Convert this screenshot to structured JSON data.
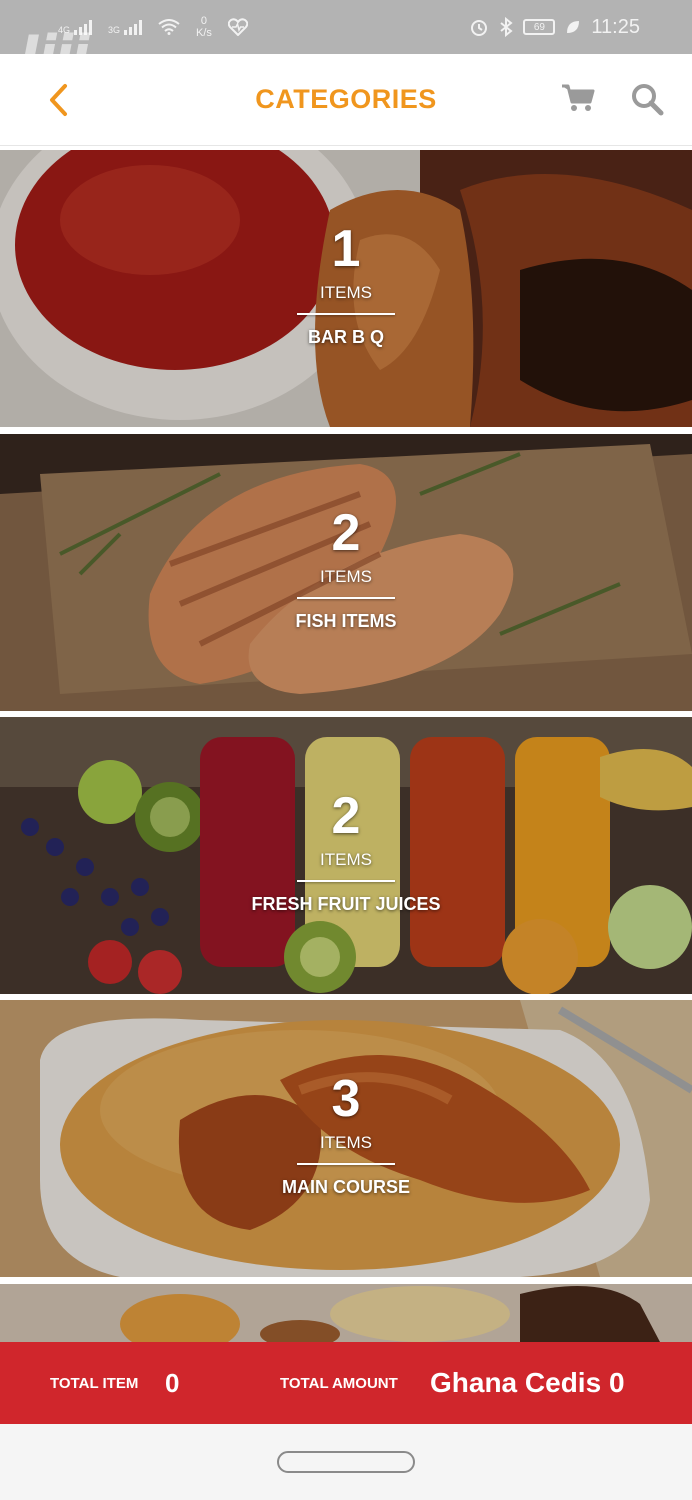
{
  "status_bar": {
    "network_left": "4G",
    "network_right": "3G",
    "speed_value": "0",
    "speed_unit": "K/s",
    "battery": "69",
    "time": "11:25"
  },
  "watermark": "Jiji",
  "header": {
    "title": "CATEGORIES",
    "back_icon": "chevron-left-icon",
    "cart_icon": "cart-icon",
    "search_icon": "search-icon"
  },
  "categories": [
    {
      "count": "1",
      "items_label": "ITEMS",
      "name": "BAR B Q",
      "theme": "bbq"
    },
    {
      "count": "2",
      "items_label": "ITEMS",
      "name": "FISH ITEMS",
      "theme": "fish"
    },
    {
      "count": "2",
      "items_label": "ITEMS",
      "name": "FRESH FRUIT JUICES",
      "theme": "juice"
    },
    {
      "count": "3",
      "items_label": "ITEMS",
      "name": "MAIN COURSE",
      "theme": "rice"
    }
  ],
  "totals": {
    "item_label": "TOTAL ITEM",
    "item_value": "0",
    "amount_label": "TOTAL AMOUNT",
    "amount_value": "Ghana Cedis 0"
  },
  "colors": {
    "accent_orange": "#f0961e",
    "total_bar_red": "#d0262c",
    "status_bar_gray": "#b3b3b3"
  }
}
